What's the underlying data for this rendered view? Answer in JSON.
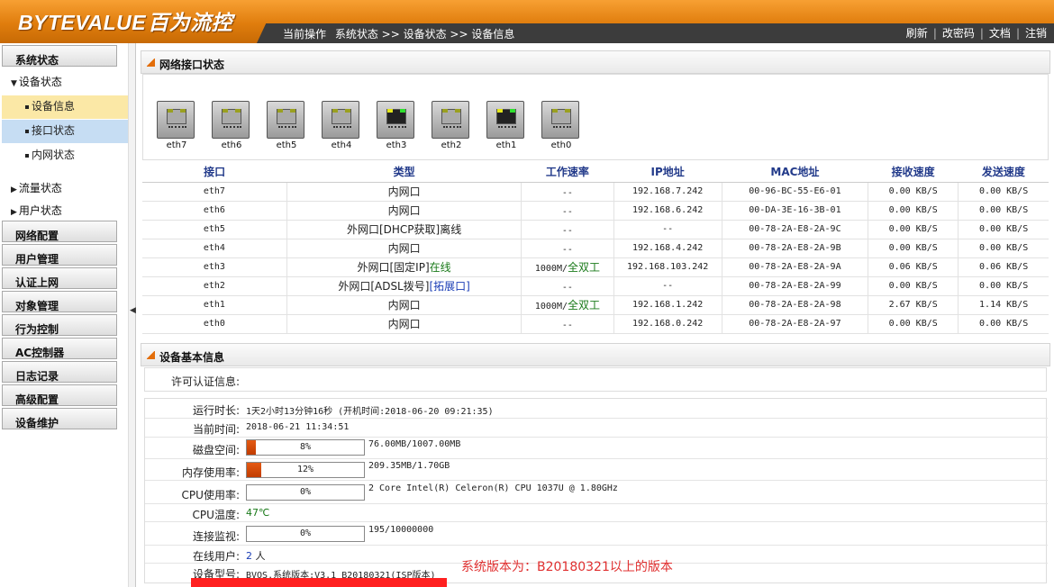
{
  "brand": {
    "logo": "BYTEVALUE",
    "logo_cn": "百为流控"
  },
  "breadcrumb": [
    "当前操作",
    "系统状态 >> 设备状态 >> 设备信息"
  ],
  "toplinks": [
    "刷新",
    "改密码",
    "文档",
    "注销"
  ],
  "sidebar": {
    "sections": [
      "系统状态",
      "网络配置",
      "用户管理",
      "认证上网",
      "对象管理",
      "行为控制",
      "AC控制器",
      "日志记录",
      "高级配置",
      "设备维护"
    ],
    "tree": {
      "device_status": "设备状态",
      "traffic_status": "流量状态",
      "user_status": "用户状态"
    },
    "device_sub": [
      "设备信息",
      "接口状态",
      "内网状态"
    ],
    "colors": {
      "active": "#fbe8a6",
      "selected": "#c6ddf3"
    }
  },
  "panels": {
    "network": "网络接口状态",
    "device": "设备基本信息"
  },
  "ports": [
    {
      "name": "eth7",
      "up": false
    },
    {
      "name": "eth6",
      "up": false
    },
    {
      "name": "eth5",
      "up": false
    },
    {
      "name": "eth4",
      "up": false
    },
    {
      "name": "eth3",
      "up": true
    },
    {
      "name": "eth2",
      "up": false
    },
    {
      "name": "eth1",
      "up": true
    },
    {
      "name": "eth0",
      "up": false
    }
  ],
  "iface_table": {
    "headers": [
      "接口",
      "类型",
      "工作速率",
      "IP地址",
      "MAC地址",
      "接收速度",
      "发送速度"
    ],
    "rows": [
      {
        "iface": "eth7",
        "type": "内网口",
        "type_extra": "",
        "speed": "--",
        "speed_extra": "",
        "ip": "192.168.7.242",
        "mac": "00-96-BC-55-E6-01",
        "rx": "0.00 KB/S",
        "tx": "0.00 KB/S"
      },
      {
        "iface": "eth6",
        "type": "内网口",
        "type_extra": "",
        "speed": "--",
        "speed_extra": "",
        "ip": "192.168.6.242",
        "mac": "00-DA-3E-16-3B-01",
        "rx": "0.00 KB/S",
        "tx": "0.00 KB/S"
      },
      {
        "iface": "eth5",
        "type": "外网口[DHCP获取]",
        "type_extra": "离线",
        "speed": "--",
        "speed_extra": "",
        "ip": "--",
        "mac": "00-78-2A-E8-2A-9C",
        "rx": "0.00 KB/S",
        "tx": "0.00 KB/S"
      },
      {
        "iface": "eth4",
        "type": "内网口",
        "type_extra": "",
        "speed": "--",
        "speed_extra": "",
        "ip": "192.168.4.242",
        "mac": "00-78-2A-E8-2A-9B",
        "rx": "0.00 KB/S",
        "tx": "0.00 KB/S"
      },
      {
        "iface": "eth3",
        "type": "外网口[固定IP]",
        "type_extra": "在线",
        "speed": "1000M/",
        "speed_extra": "全双工",
        "ip": "192.168.103.242",
        "mac": "00-78-2A-E8-2A-9A",
        "rx": "0.06 KB/S",
        "tx": "0.06 KB/S"
      },
      {
        "iface": "eth2",
        "type": "外网口[ADSL拨号]",
        "type_extra": "[拓展口]",
        "speed": "--",
        "speed_extra": "",
        "ip": "--",
        "mac": "00-78-2A-E8-2A-99",
        "rx": "0.00 KB/S",
        "tx": "0.00 KB/S"
      },
      {
        "iface": "eth1",
        "type": "内网口",
        "type_extra": "",
        "speed": "1000M/",
        "speed_extra": "全双工",
        "ip": "192.168.1.242",
        "mac": "00-78-2A-E8-2A-98",
        "rx": "2.67 KB/S",
        "tx": "1.14 KB/S"
      },
      {
        "iface": "eth0",
        "type": "内网口",
        "type_extra": "",
        "speed": "--",
        "speed_extra": "",
        "ip": "192.168.0.242",
        "mac": "00-78-2A-E8-2A-97",
        "rx": "0.00 KB/S",
        "tx": "0.00 KB/S"
      }
    ]
  },
  "info": {
    "license_label": "许可认证信息:",
    "uptime_label": "运行时长:",
    "uptime": "1天2小时13分钟16秒 (开机时间:2018-06-20 09:21:35)",
    "now_label": "当前时间:",
    "now": "2018-06-21 11:34:51",
    "disk_label": "磁盘空间:",
    "disk_pct": 8,
    "disk_pct_text": "8%",
    "disk_detail": "76.00MB/1007.00MB",
    "mem_label": "内存使用率:",
    "mem_pct": 12,
    "mem_pct_text": "12%",
    "mem_detail": "209.35MB/1.70GB",
    "cpu_label": "CPU使用率:",
    "cpu_pct": 0,
    "cpu_pct_text": "0%",
    "cpu_detail": "2 Core Intel(R) Celeron(R) CPU 1037U @ 1.80GHz",
    "temp_label": "CPU温度:",
    "temp": "47℃",
    "conn_label": "连接监视:",
    "conn_pct": 0,
    "conn_pct_text": "0%",
    "conn_detail": "195/10000000",
    "online_label": "在线用户:",
    "online_count": "2",
    "online_unit": "人",
    "model_label": "设备型号:",
    "model": "BVOS,系统版本:V3.1 B20180321(ISP版本)",
    "note": "系统版本为：B20180321以上的版本"
  }
}
